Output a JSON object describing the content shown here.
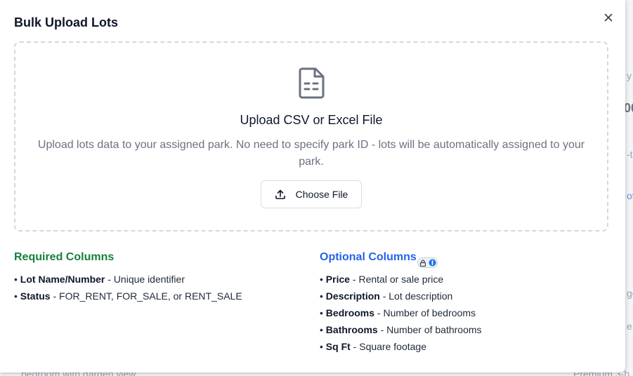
{
  "modal": {
    "title": "Bulk Upload Lots",
    "close_icon": "close-icon"
  },
  "dropzone": {
    "icon": "file-spreadsheet-icon",
    "heading": "Upload CSV or Excel File",
    "description": "Upload lots data to your assigned park. No need to specify park ID - lots will be automatically assigned to your park.",
    "button_label": "Choose File",
    "button_icon": "upload-icon"
  },
  "required_columns": {
    "heading": "Required Columns",
    "items": [
      {
        "name": "Lot Name/Number",
        "desc": " - Unique identifier"
      },
      {
        "name": "Status",
        "desc": " - FOR_RENT, FOR_SALE, or RENT_SALE"
      }
    ]
  },
  "optional_columns": {
    "heading": "Optional Columns",
    "items": [
      {
        "name": "Price",
        "desc": " - Rental or sale price"
      },
      {
        "name": "Description",
        "desc": " - Lot description"
      },
      {
        "name": "Bedrooms",
        "desc": " - Number of bedrooms"
      },
      {
        "name": "Bathrooms",
        "desc": " - Number of bathrooms"
      },
      {
        "name": "Sq Ft",
        "desc": " - Square footage"
      }
    ]
  },
  "background": {
    "fragments": [
      "y",
      "00",
      "-t",
      "ot",
      "ge",
      "e",
      "bedroom with garden view",
      "Premium 3-b"
    ]
  },
  "colors": {
    "required_heading": "#15803d",
    "optional_heading": "#2563eb",
    "text_muted": "#6b7280"
  }
}
